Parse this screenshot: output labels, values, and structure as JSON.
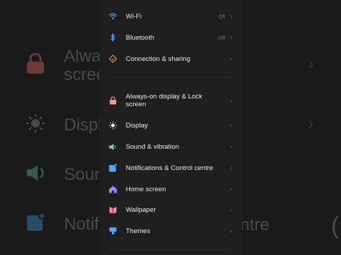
{
  "background": {
    "rows": [
      {
        "text": "Always-on display & Lock screen",
        "line1": "Alwa",
        "line2": "scree",
        "icon": "lock-icon"
      },
      {
        "text": "Display",
        "line1": "Displ",
        "icon": "sun-icon"
      },
      {
        "text": "Sound",
        "line1": "Soun",
        "icon": "speaker-icon"
      },
      {
        "text": "Notifications",
        "line1": "Notif",
        "icon": "notification-icon"
      }
    ],
    "right_fragment": "ntre"
  },
  "settings": {
    "group1": [
      {
        "label": "Wi-Fi",
        "value": "Off",
        "icon": "wifi-icon",
        "color": "#4ea8ff"
      },
      {
        "label": "Bluetooth",
        "value": "Off",
        "icon": "bluetooth-icon",
        "color": "#4ea8ff"
      },
      {
        "label": "Connection & sharing",
        "value": "",
        "icon": "connection-icon",
        "color": "#f08a5d"
      }
    ],
    "group2": [
      {
        "label": "Always-on display & Lock screen",
        "icon": "lock-icon",
        "color": "#f29a8e"
      },
      {
        "label": "Display",
        "icon": "sun-icon",
        "color": "#ffffff"
      },
      {
        "label": "Sound & vibration",
        "icon": "speaker-icon",
        "color": "#6fd3a7"
      },
      {
        "label": "Notifications & Control centre",
        "icon": "notification-icon",
        "color": "#4ea8ff"
      },
      {
        "label": "Home screen",
        "icon": "home-icon",
        "color": "#9a8cff"
      },
      {
        "label": "Wallpaper",
        "icon": "wallpaper-icon",
        "color": "#ff7fa8"
      },
      {
        "label": "Themes",
        "icon": "themes-icon",
        "color": "#4ea8ff"
      }
    ]
  }
}
